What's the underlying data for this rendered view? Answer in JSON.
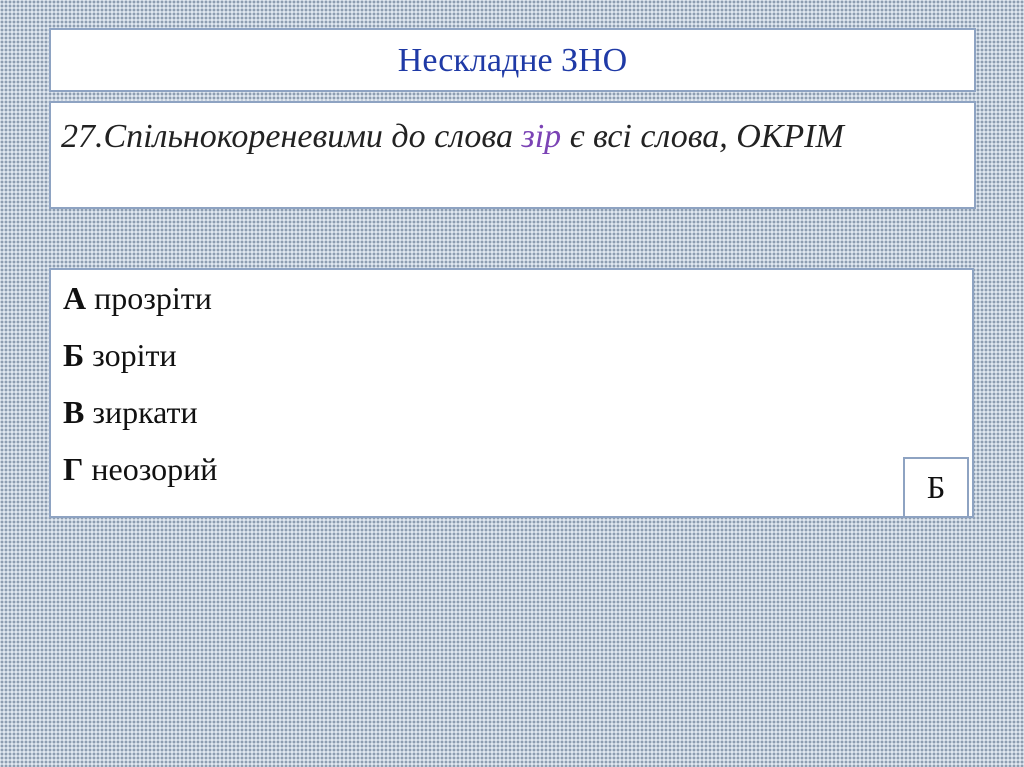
{
  "header": {
    "title": "Нескладне ЗНО"
  },
  "question": {
    "before": "27.Спільнокореневими до слова ",
    "highlight": "зір",
    "after": " є всі слова, ОКРІМ",
    "highlight_color": "#7b43b5"
  },
  "options": [
    {
      "letter": "А",
      "text": " прозріти"
    },
    {
      "letter": "Б",
      "text": " зоріти"
    },
    {
      "letter": "В",
      "text": " зиркати"
    },
    {
      "letter": "Г",
      "text": " неозорий"
    }
  ],
  "answer": {
    "value": "Б"
  },
  "colors": {
    "title": "#1f3aa6",
    "border": "#8ea3c2",
    "background": "#c3cfdc"
  }
}
